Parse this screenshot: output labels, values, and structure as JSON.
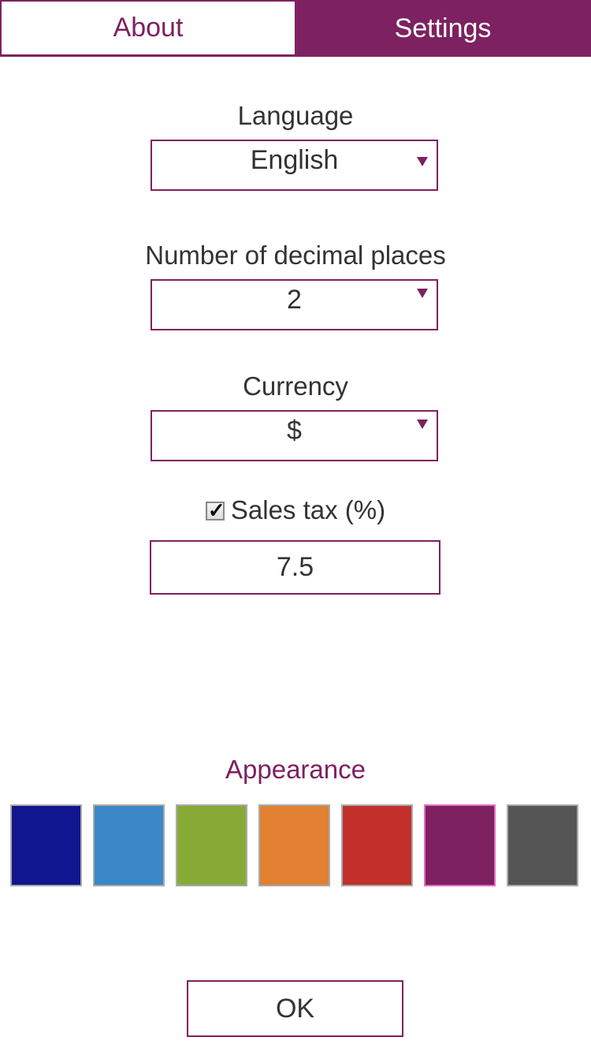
{
  "tabs": [
    {
      "label": "About",
      "active": false
    },
    {
      "label": "Settings",
      "active": true
    }
  ],
  "settings": {
    "language": {
      "label": "Language",
      "value": "English"
    },
    "decimal_places": {
      "label": "Number of decimal places",
      "value": "2"
    },
    "currency": {
      "label": "Currency",
      "value": "$"
    },
    "sales_tax": {
      "label": "Sales tax (%)",
      "checked": true,
      "check_glyph": "✓",
      "value": "7.5"
    }
  },
  "appearance": {
    "title": "Appearance",
    "swatches": [
      {
        "name": "dark-blue",
        "color": "#10168f",
        "selected": false
      },
      {
        "name": "light-blue",
        "color": "#3a88c7",
        "selected": false
      },
      {
        "name": "green",
        "color": "#87aa37",
        "selected": false
      },
      {
        "name": "orange",
        "color": "#e08030",
        "selected": false
      },
      {
        "name": "red",
        "color": "#c1302a",
        "selected": false
      },
      {
        "name": "purple",
        "color": "#7d2160",
        "selected": true
      },
      {
        "name": "gray",
        "color": "#555555",
        "selected": false
      }
    ]
  },
  "colors": {
    "accent": "#7d2160",
    "selected_swatch_border": "#e070c0"
  },
  "ok_label": "OK"
}
